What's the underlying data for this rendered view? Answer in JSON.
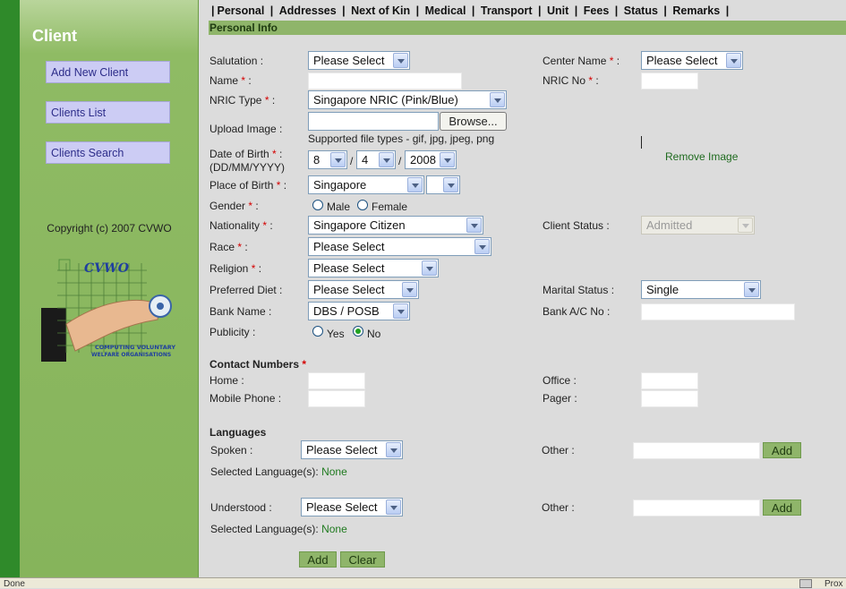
{
  "sidebar": {
    "title": "Client",
    "buttons": [
      "Add New Client",
      "Clients List",
      "Clients Search"
    ],
    "copyright": "Copyright (c) 2007 CVWO",
    "logo": {
      "text_top": "CVWO",
      "text_bottom_1": "COMPUTING VOLUNTARY",
      "text_bottom_2": "WELFARE ORGANISATIONS"
    }
  },
  "tabs": [
    "Personal",
    "Addresses",
    "Next of Kin",
    "Medical",
    "Transport",
    "Unit",
    "Fees",
    "Status",
    "Remarks"
  ],
  "section_title": "Personal Info",
  "form": {
    "salutation": {
      "label": "Salutation :",
      "value": "Please Select"
    },
    "name": {
      "label": "Name",
      "suffix": " :"
    },
    "nric_type": {
      "label": "NRIC Type",
      "suffix": " :",
      "value": "Singapore NRIC (Pink/Blue)"
    },
    "upload_image": {
      "label": "Upload Image :",
      "browse": "Browse...",
      "note": "Supported file types - gif, jpg, jpeg, png"
    },
    "dob": {
      "label": "Date of Birth",
      "suffix": " :",
      "format": "(DD/MM/YYYY)",
      "day": "8",
      "month": "4",
      "year": "2008",
      "sep": "/"
    },
    "place_of_birth": {
      "label": "Place of Birth",
      "suffix": " :",
      "value": "Singapore"
    },
    "gender": {
      "label": "Gender",
      "suffix": " :",
      "options": [
        "Male",
        "Female"
      ]
    },
    "nationality": {
      "label": "Nationality",
      "suffix": " :",
      "value": "Singapore Citizen"
    },
    "race": {
      "label": "Race",
      "suffix": " :",
      "value": "Please Select"
    },
    "religion": {
      "label": "Religion",
      "suffix": " :",
      "value": "Please Select"
    },
    "preferred_diet": {
      "label": "Preferred Diet :",
      "value": "Please Select"
    },
    "bank_name": {
      "label": "Bank Name :",
      "value": "DBS / POSB"
    },
    "publicity": {
      "label": "Publicity :",
      "options": [
        "Yes",
        "No"
      ],
      "selected": "No"
    },
    "center_name": {
      "label": "Center Name",
      "suffix": " :",
      "value": "Please Select"
    },
    "nric_no": {
      "label": "NRIC No",
      "suffix": " :"
    },
    "remove_image": "Remove Image",
    "client_status": {
      "label": "Client Status :",
      "value": "Admitted"
    },
    "marital_status": {
      "label": "Marital Status :",
      "value": "Single"
    },
    "bank_ac_no": {
      "label": "Bank A/C No :"
    },
    "required_mark": "*"
  },
  "contact": {
    "heading": "Contact Numbers",
    "home": "Home :",
    "mobile": "Mobile Phone :",
    "office": "Office :",
    "pager": "Pager :"
  },
  "languages": {
    "heading": "Languages",
    "spoken": {
      "label": "Spoken :",
      "value": "Please Select"
    },
    "understood": {
      "label": "Understood :",
      "value": "Please Select"
    },
    "other_label": "Other :",
    "add": "Add",
    "selected_label": "Selected Language(s):",
    "none": "None"
  },
  "actions": {
    "add": "Add",
    "clear": "Clear"
  },
  "statusbar": {
    "status": "Done",
    "right": "Prox"
  }
}
